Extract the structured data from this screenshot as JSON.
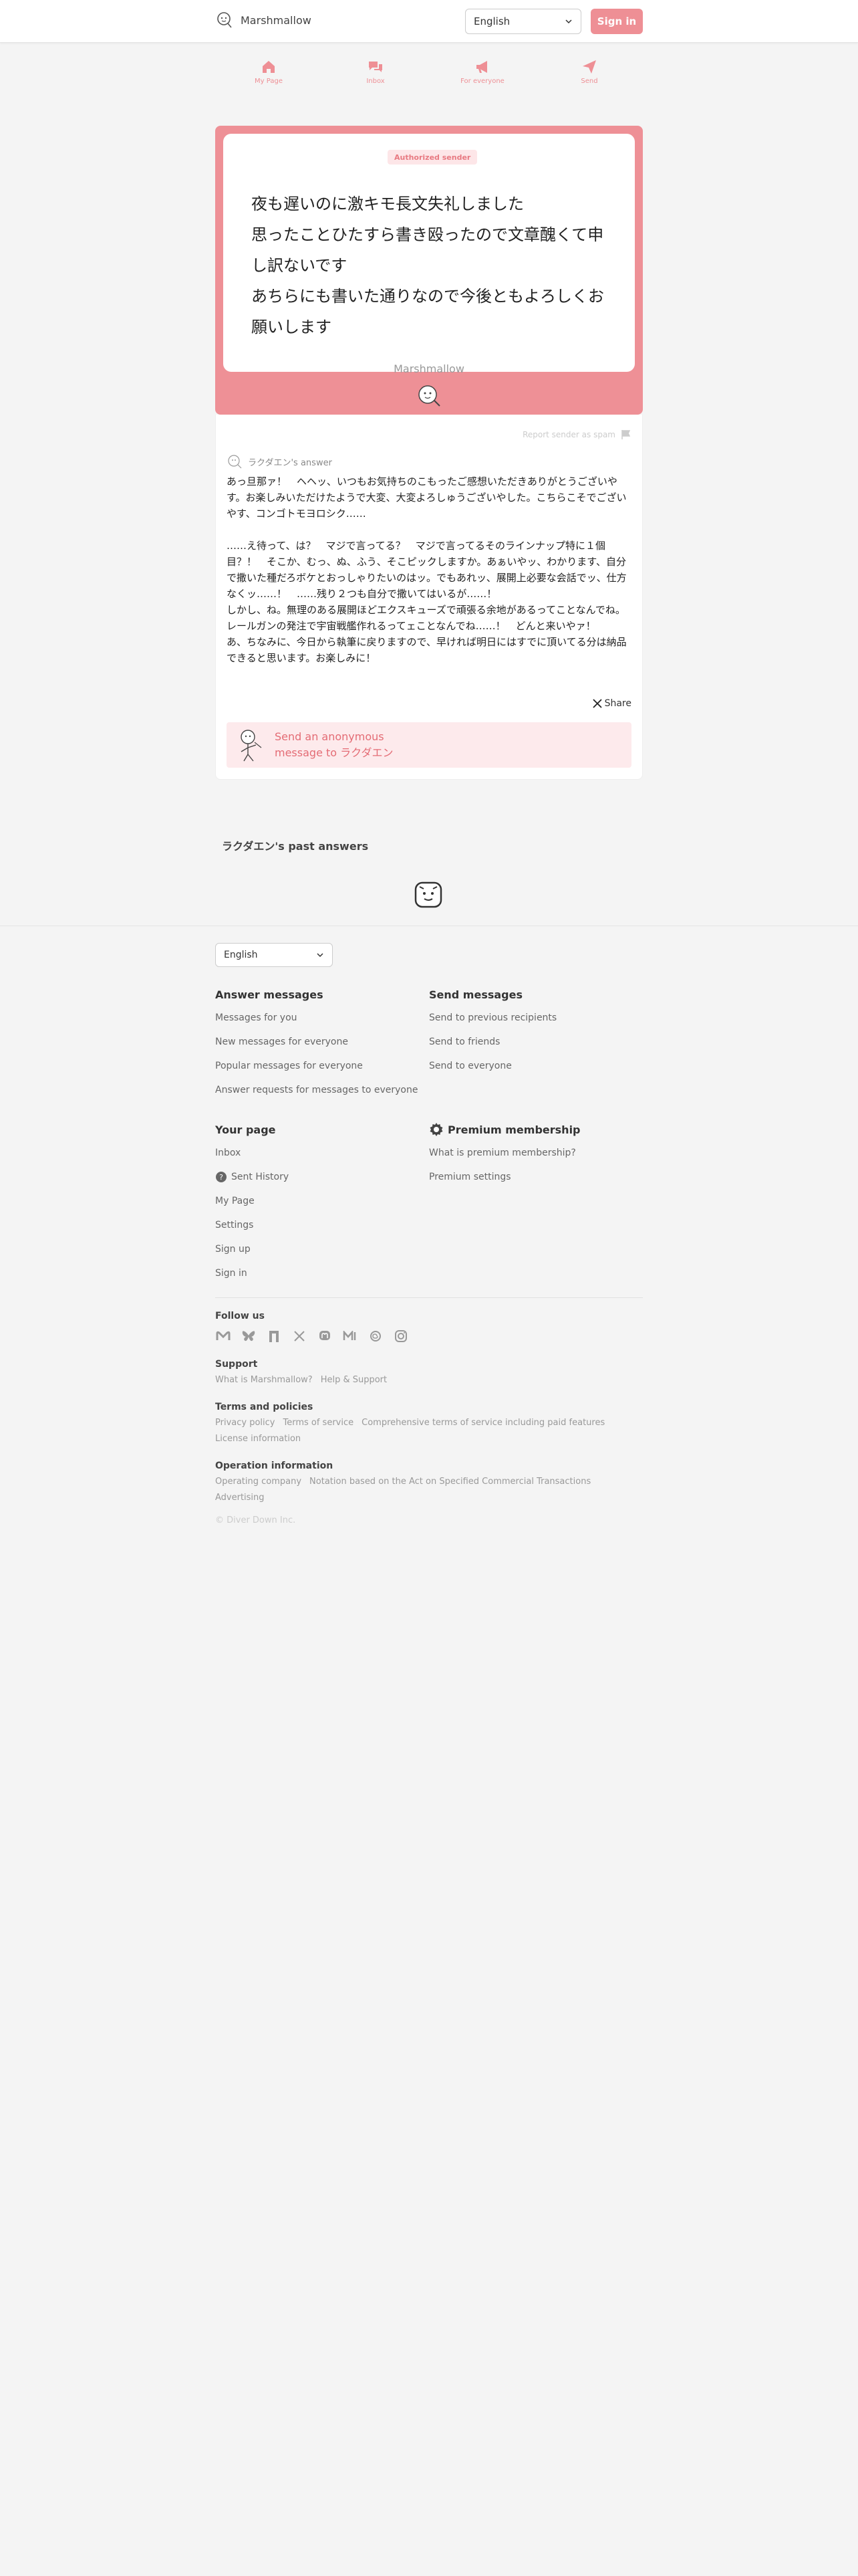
{
  "header": {
    "logo_text": "Marshmallow",
    "language": "English",
    "signin_label": "Sign in"
  },
  "nav": [
    {
      "label": "My Page",
      "icon": "house-icon"
    },
    {
      "label": "Inbox",
      "icon": "chat-bubbles-icon"
    },
    {
      "label": "For everyone",
      "icon": "megaphone-icon"
    },
    {
      "label": "Send",
      "icon": "paper-plane-icon"
    }
  ],
  "message": {
    "badge": "Authorized sender",
    "text": "夜も遅いのに激キモ長文失礼しました\n思ったことひたすら書き殴ったので文章醜くて申し訳ないです\nあちらにも書いた通りなので今後ともよろしくお願いします",
    "brand": "Marshmallow"
  },
  "answer": {
    "report_label": "Report sender as spam",
    "answerer_label": "ラクダエン's answer",
    "text": "あっ旦那ァ！　ヘヘッ、いつもお気持ちのこもったご感想いただきありがとうございやす。お楽しみいただけたようで大変、大変よろしゅうございやした。こちらこそでございやす、コンゴトモヨロシク……\n\n……え待って、は？　マジで言ってる？　マジで言ってるそのラインナップ特に１個目？！　そこか、むっ、ぬ、ふう、そこピックしますか。あぁいやッ、わかります、自分で撒いた種だろボケとおっしゃりたいのはッ。でもあれッ、展開上必要な会話でッ、仕方なくッ……！　……残り２つも自分で撒いてはいるが……！\nしかし、ね。無理のある展開ほどエクスキューズで頑張る余地があるってことなんでね。レールガンの発注で宇宙戦艦作れるってェことなんでね……！　どんと来いやァ！\nあ、ちなみに、今日から執筆に戻りますので、早ければ明日にはすでに頂いてる分は納品できると思います。お楽しみに！",
    "share_label": "Share",
    "send_anon": "Send an anonymous message to ラクダエン"
  },
  "past": {
    "title": "ラクダエン's past answers"
  },
  "footer": {
    "language": "English",
    "answer_messages": {
      "title": "Answer messages",
      "items": [
        "Messages for you",
        "New messages for everyone",
        "Popular messages for everyone",
        "Answer requests for messages to everyone"
      ]
    },
    "send_messages": {
      "title": "Send messages",
      "items": [
        "Send to previous recipients",
        "Send to friends",
        "Send to everyone"
      ]
    },
    "your_page": {
      "title": "Your page",
      "items": [
        "Inbox",
        "Sent History",
        "My Page",
        "Settings",
        "Sign up",
        "Sign in"
      ]
    },
    "premium": {
      "title": "Premium membership",
      "items": [
        "What is premium membership?",
        "Premium settings"
      ]
    },
    "follow_us": "Follow us",
    "socials": [
      "misskey-icon",
      "bluesky-icon",
      "note-icon",
      "x-icon",
      "mastodon-icon",
      "misskey-io-icon",
      "threads-icon",
      "instagram-icon"
    ],
    "support": {
      "title": "Support",
      "items": [
        "What is Marshmallow?",
        "Help & Support"
      ]
    },
    "terms": {
      "title": "Terms and policies",
      "items": [
        "Privacy policy",
        "Terms of service",
        "Comprehensive terms of service including paid features",
        "License information"
      ]
    },
    "operation": {
      "title": "Operation information",
      "items": [
        "Operating company",
        "Notation based on the Act on Specified Commercial Transactions",
        "Advertising"
      ]
    },
    "copyright": "© Diver Down Inc."
  },
  "colors": {
    "accent": "#ee8f95",
    "accent_light": "#fdeaec",
    "background": "#f4f4f4"
  }
}
